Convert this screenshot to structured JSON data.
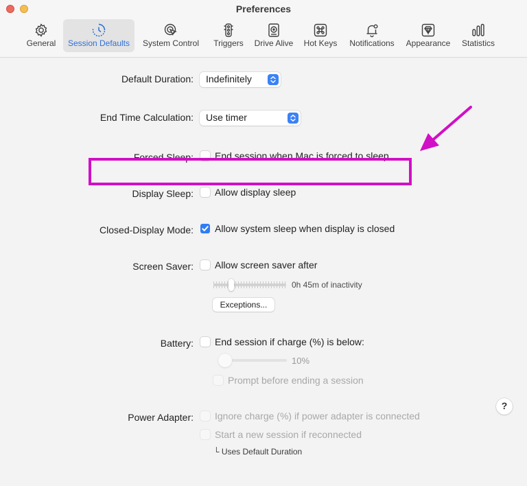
{
  "window": {
    "title": "Preferences"
  },
  "toolbar": {
    "tabs": [
      {
        "label": "General",
        "icon": "gear-icon"
      },
      {
        "label": "Session Defaults",
        "icon": "clock-icon",
        "active": true
      },
      {
        "label": "System Control",
        "icon": "cursor-click-icon"
      },
      {
        "label": "Triggers",
        "icon": "traffic-light-icon"
      },
      {
        "label": "Drive Alive",
        "icon": "hard-drive-icon"
      },
      {
        "label": "Hot Keys",
        "icon": "command-key-icon"
      },
      {
        "label": "Notifications",
        "icon": "bell-icon"
      },
      {
        "label": "Appearance",
        "icon": "diamond-icon"
      },
      {
        "label": "Statistics",
        "icon": "bar-chart-icon"
      }
    ]
  },
  "colors": {
    "accent": "#2f7df6",
    "highlight": "#d10fc6",
    "active_tab_text": "#2f6fd8"
  },
  "settings": {
    "default_duration": {
      "label": "Default Duration:",
      "value": "Indefinitely"
    },
    "end_time": {
      "label": "End Time Calculation:",
      "value": "Use timer"
    },
    "forced_sleep": {
      "label": "Forced Sleep:",
      "option": "End session when Mac is forced to sleep",
      "checked": false
    },
    "display_sleep": {
      "label": "Display Sleep:",
      "option": "Allow display sleep",
      "checked": false
    },
    "closed_display": {
      "label": "Closed-Display Mode:",
      "option": "Allow system sleep when display is closed",
      "checked": true
    },
    "screen_saver": {
      "label": "Screen Saver:",
      "option": "Allow screen saver after",
      "checked": false,
      "inactivity_text": "0h 45m of inactivity",
      "exceptions_button": "Exceptions..."
    },
    "battery": {
      "label": "Battery:",
      "option": "End session if charge (%) is below:",
      "checked": false,
      "charge_value": "10%",
      "prompt_option": "Prompt before ending a session"
    },
    "power_adapter": {
      "label": "Power Adapter:",
      "ignore_option": "Ignore charge (%) if power adapter is connected",
      "restart_option": "Start a new session if reconnected",
      "note": "└ Uses Default Duration"
    }
  },
  "help_button": "?"
}
